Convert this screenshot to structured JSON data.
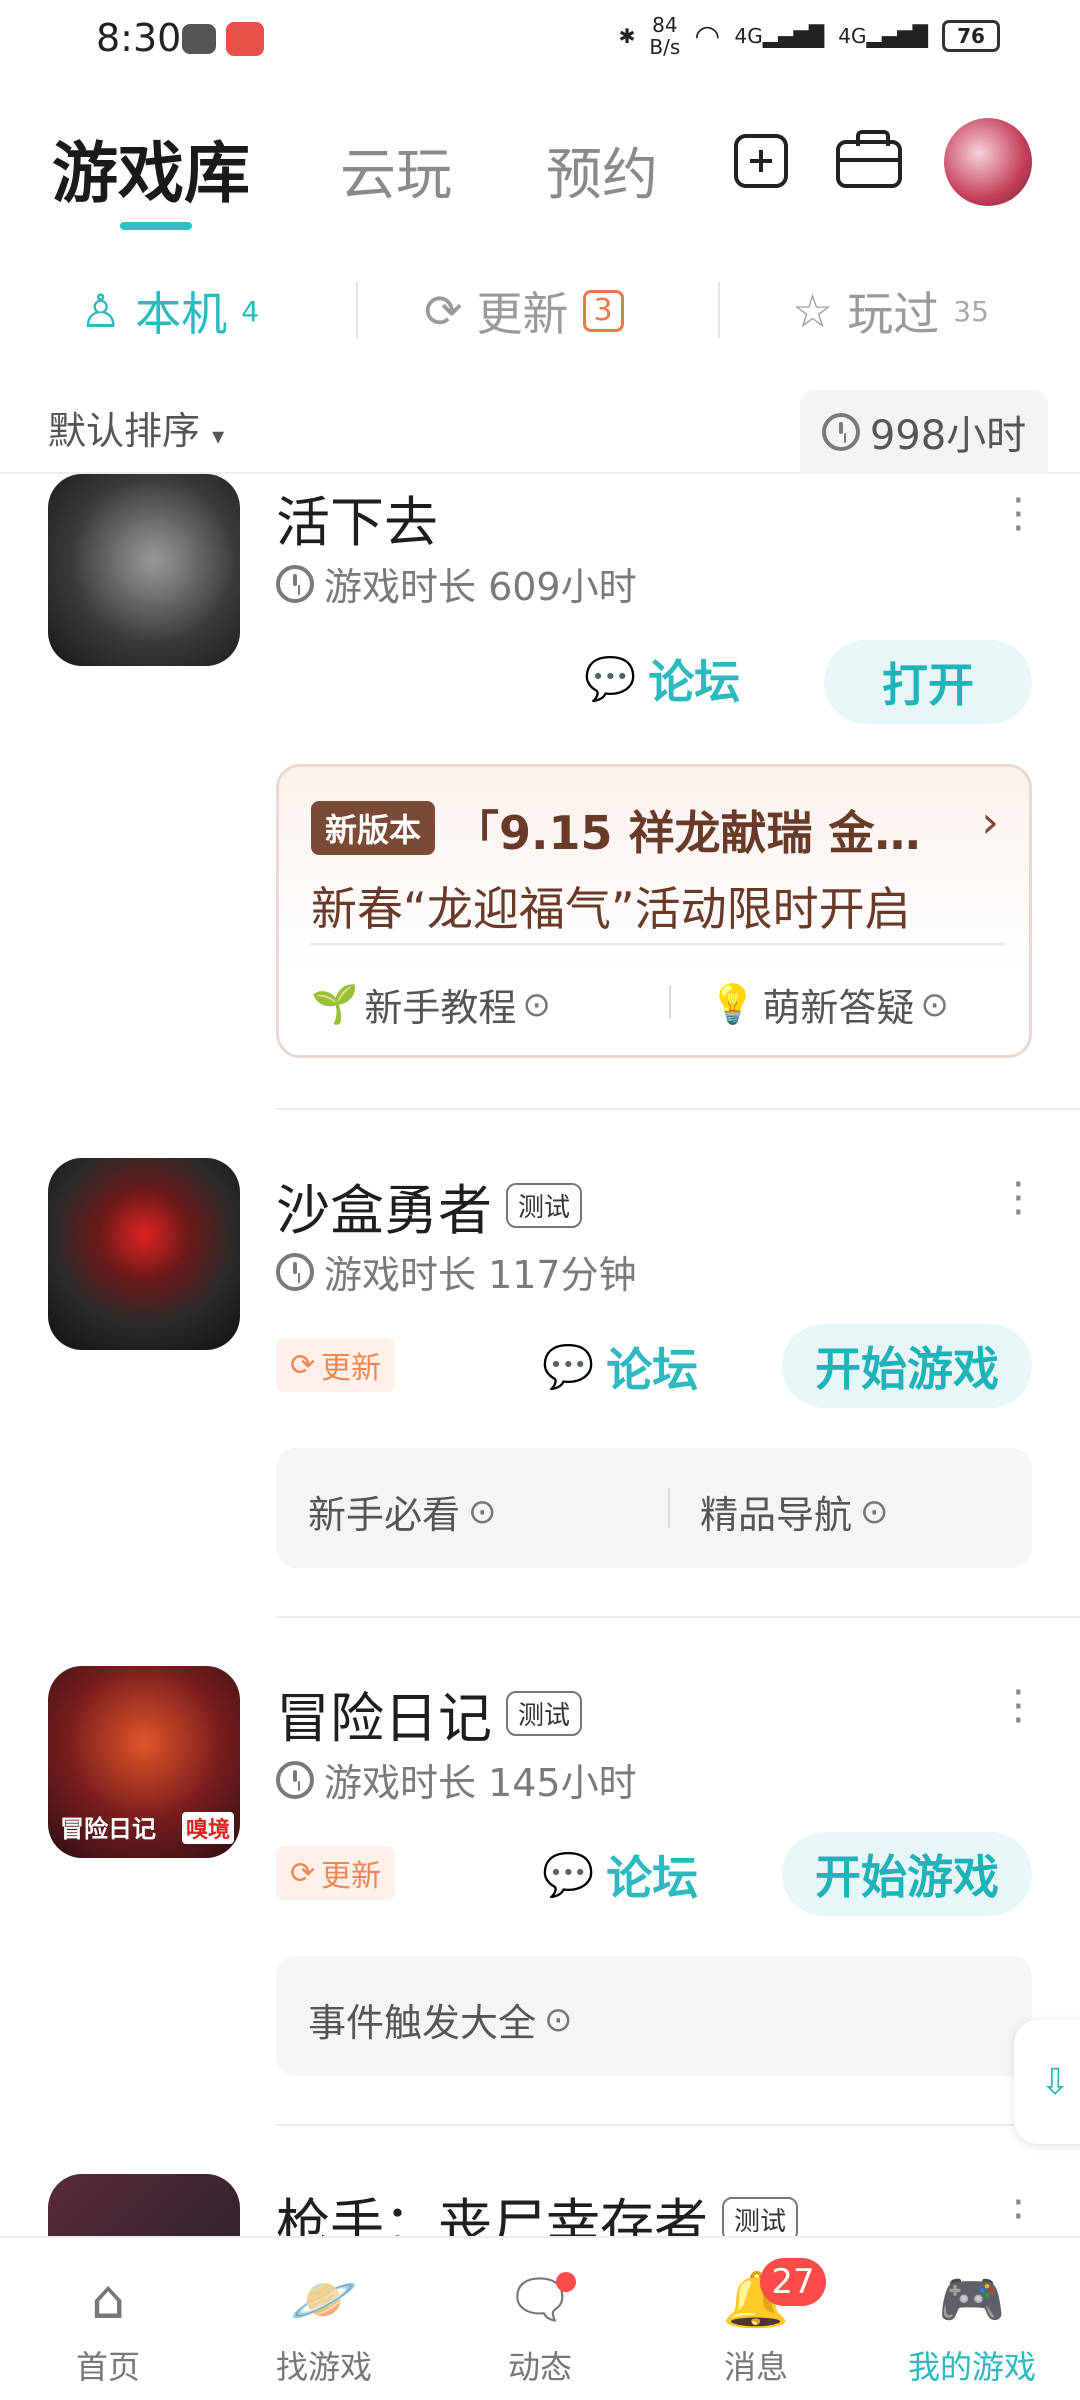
{
  "status_bar": {
    "time": "8:30",
    "net_speed_value": "84",
    "net_speed_unit": "B/s",
    "signal1": "4G",
    "signal2": "4G",
    "battery": "76"
  },
  "top_nav": {
    "tabs": [
      "游戏库",
      "云玩",
      "预约"
    ],
    "active_tab": "游戏库"
  },
  "sub_tabs": {
    "local": {
      "label": "本机",
      "count": "4"
    },
    "update": {
      "label": "更新",
      "count": "3"
    },
    "played": {
      "label": "玩过",
      "count": "35"
    }
  },
  "sort": {
    "label": "默认排序",
    "total_time": "998小时"
  },
  "games": [
    {
      "title": "活下去",
      "time": "游戏时长 609小时",
      "forum": "论坛",
      "action": "打开",
      "news": {
        "tag": "新版本",
        "title": "「9.15 祥龙献瑞 金…",
        "subtitle": "新春“龙迎福气”活动限时开启",
        "link1": "新手教程",
        "link2": "萌新答疑"
      }
    },
    {
      "title": "沙盒勇者",
      "tag": "测试",
      "time": "游戏时长 117分钟",
      "update_tag": "更新",
      "forum": "论坛",
      "action": "开始游戏",
      "links": [
        "新手必看",
        "精品导航"
      ]
    },
    {
      "title": "冒险日记",
      "tag": "测试",
      "icon_text": "冒险日记",
      "icon_badge": "嗅境",
      "time": "游戏时长 145小时",
      "update_tag": "更新",
      "forum": "论坛",
      "action": "开始游戏",
      "links": [
        "事件触发大全"
      ]
    },
    {
      "title": "枪手：丧尸幸存者",
      "tag": "测试"
    }
  ],
  "bottom_nav": {
    "items": [
      "首页",
      "找游戏",
      "动态",
      "消息",
      "我的游戏"
    ],
    "message_badge": "27",
    "active": "我的游戏"
  },
  "colors": {
    "accent": "#2cb9bf",
    "update_orange": "#e9784b",
    "badge_red": "#ff4a4a"
  }
}
